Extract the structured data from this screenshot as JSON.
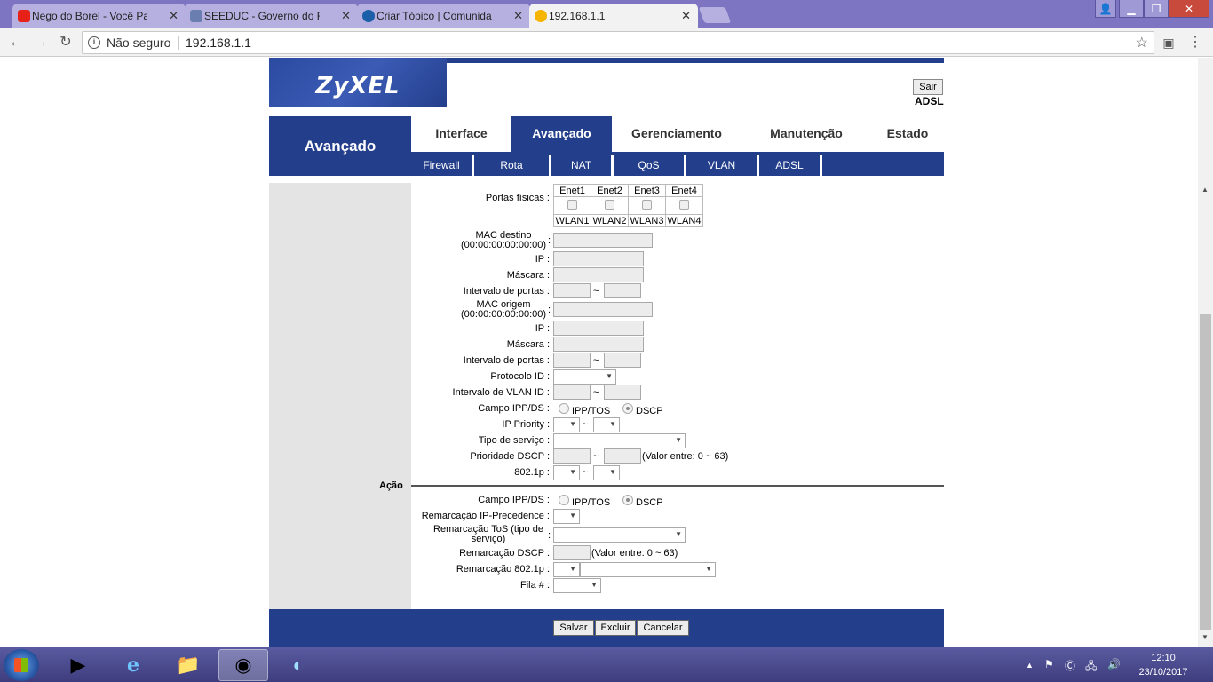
{
  "browser": {
    "tabs": [
      {
        "title": "Nego do Borel - Você Pa",
        "favicon_color": "#e62117"
      },
      {
        "title": "SEEDUC - Governo do Ri",
        "favicon_color": "#6a7fb0"
      },
      {
        "title": "Criar Tópico | Comunidad",
        "favicon_color": "#1a5fa8"
      },
      {
        "title": "192.168.1.1",
        "favicon_color": "#f5b400"
      }
    ],
    "security_label": "Não seguro",
    "url": "192.168.1.1"
  },
  "header": {
    "logo": "ZyXEL",
    "logout_label": "Sair",
    "product": "ADSL"
  },
  "section_title": "Avançado",
  "main_tabs": [
    "Interface",
    "Avançado",
    "Gerenciamento",
    "Manutenção",
    "Estado"
  ],
  "sub_tabs": [
    "Firewall",
    "Rota",
    "NAT",
    "QoS",
    "VLAN",
    "ADSL"
  ],
  "form": {
    "ports_label": "Portas físicas :",
    "ports_enet": [
      "Enet1",
      "Enet2",
      "Enet3",
      "Enet4"
    ],
    "ports_wlan": [
      "WLAN1",
      "WLAN2",
      "WLAN3",
      "WLAN4"
    ],
    "mac_dest_label": "MAC destino",
    "mac_dest_hint": "(00:00:00:00:00:00)",
    "ip_label": "IP :",
    "mask_label": "Máscara :",
    "port_range_label": "Intervalo de portas :",
    "mac_src_label": "MAC origem",
    "mac_src_hint": "(00:00:00:00:00:00)",
    "protocol_label": "Protocolo ID :",
    "vlan_range_label": "Intervalo de VLAN ID :",
    "ipp_ds_label": "Campo IPP/DS :",
    "ipp_tos_option": "IPP/TOS",
    "dscp_option": "DSCP",
    "ip_priority_label": "IP Priority :",
    "tos_label": "Tipo de serviço :",
    "dscp_priority_label": "Prioridade DSCP :",
    "dscp_range_note": "(Valor entre: 0 ~ 63)",
    "dot1p_label": "802.1p :",
    "tilde": "~"
  },
  "action": {
    "title": "Ação",
    "ipp_ds_label": "Campo IPP/DS :",
    "ipp_tos_option": "IPP/TOS",
    "dscp_option": "DSCP",
    "remark_ipprec_label": "Remarcação IP-Precedence :",
    "remark_tos_label_1": "Remarcação ToS (tipo de",
    "remark_tos_label_2": "serviço)",
    "remark_dscp_label": "Remarcação DSCP :",
    "dscp_range_note": "(Valor entre: 0 ~ 63)",
    "remark_8021p_label": "Remarcação 802.1p :",
    "queue_label": "Fila # :"
  },
  "buttons": {
    "save": "Salvar",
    "delete": "Excluir",
    "cancel": "Cancelar"
  },
  "taskbar": {
    "time": "12:10",
    "date": "23/10/2017"
  },
  "colors": {
    "brand_blue": "#233e8b",
    "panel_gray": "#e4e4e4"
  }
}
